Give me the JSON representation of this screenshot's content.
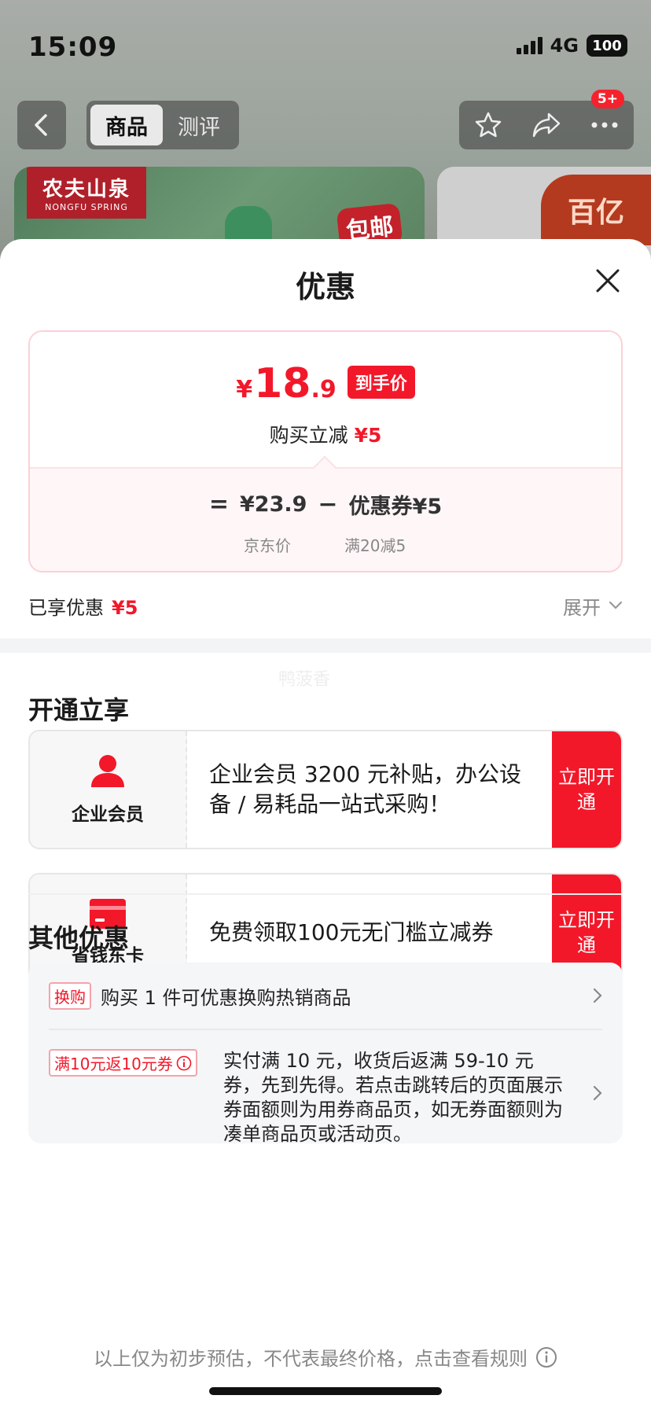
{
  "status_bar": {
    "time": "15:09",
    "network": "4G",
    "battery": "100"
  },
  "nav": {
    "tabs": [
      {
        "label": "商品",
        "active": true
      },
      {
        "label": "测评",
        "active": false
      }
    ],
    "badge": "5+"
  },
  "banner": {
    "brand_cn": "农夫山泉",
    "brand_en": "NONGFU SPRING",
    "promo_text": "包邮",
    "right_tag": "百亿"
  },
  "sheet": {
    "title": "优惠",
    "price": {
      "currency": "¥",
      "integer": "18",
      "decimal": ".9",
      "tag": "到手价",
      "subtitle": "购买立减",
      "subtitle_amount": "¥5"
    },
    "formula": {
      "equals": "=",
      "jd_price": "¥23.9",
      "minus": "−",
      "coupon": "优惠券¥5",
      "jd_price_label": "京东价",
      "coupon_label": "满20减5"
    },
    "enjoyed": {
      "label": "已享优惠",
      "amount": "¥5",
      "expand": "展开"
    },
    "watermark": "鸭菠香",
    "open_section": {
      "title": "开通立享",
      "cards": [
        {
          "name": "企业会员",
          "icon": "user-icon",
          "desc": "企业会员 3200 元补贴，办公设备 / 易耗品一站式采购！",
          "button": "立即开通"
        },
        {
          "name": "省钱东卡",
          "icon": "card-icon",
          "desc": "免费领取100元无门槛立减券",
          "button": "立即开通"
        }
      ]
    },
    "other_section": {
      "title": "其他优惠",
      "items": [
        {
          "tag": "换购",
          "text": "购买 1 件可优惠换购热销商品"
        },
        {
          "tag": "满10元返10元券",
          "text": "实付满 10 元，收货后返满 59-10 元券，先到先得。若点击跳转后的页面展示券面额则为用券商品页，如无券面额则为凑单商品页或活动页。"
        }
      ]
    },
    "footer": "以上仅为初步预估，不代表最终价格，点击查看规则"
  },
  "colors": {
    "accent": "#f2182a",
    "card_border": "#fbd1d6",
    "muted": "#888888"
  }
}
